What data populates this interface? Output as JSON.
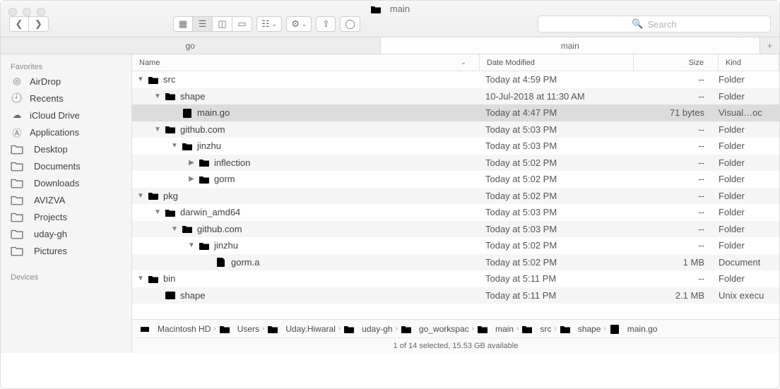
{
  "window": {
    "title": "main"
  },
  "search": {
    "placeholder": "Search"
  },
  "tabs": [
    {
      "label": "go",
      "active": false
    },
    {
      "label": "main",
      "active": true
    }
  ],
  "columns": {
    "name": "Name",
    "date": "Date Modified",
    "size": "Size",
    "kind": "Kind"
  },
  "sidebar": {
    "favorites_header": "Favorites",
    "devices_header": "Devices",
    "items": [
      {
        "label": "AirDrop",
        "icon": "airdrop"
      },
      {
        "label": "Recents",
        "icon": "clock"
      },
      {
        "label": "iCloud Drive",
        "icon": "cloud"
      },
      {
        "label": "Applications",
        "icon": "apps"
      },
      {
        "label": "Desktop",
        "icon": "folder"
      },
      {
        "label": "Documents",
        "icon": "folder"
      },
      {
        "label": "Downloads",
        "icon": "folder"
      },
      {
        "label": "AVIZVA",
        "icon": "folder"
      },
      {
        "label": "Projects",
        "icon": "folder"
      },
      {
        "label": "uday-gh",
        "icon": "folder"
      },
      {
        "label": "Pictures",
        "icon": "folder"
      }
    ]
  },
  "rows": [
    {
      "indent": 0,
      "arrow": "down",
      "icon": "folder",
      "name": "src",
      "date": "Today at 4:59 PM",
      "size": "--",
      "kind": "Folder",
      "sel": false
    },
    {
      "indent": 1,
      "arrow": "down",
      "icon": "folder",
      "name": "shape",
      "date": "10-Jul-2018 at 11:30 AM",
      "size": "--",
      "kind": "Folder",
      "sel": false
    },
    {
      "indent": 2,
      "arrow": "",
      "icon": "gofile",
      "name": "main.go",
      "date": "Today at 4:47 PM",
      "size": "71 bytes",
      "kind": "Visual…oc",
      "sel": true
    },
    {
      "indent": 1,
      "arrow": "down",
      "icon": "folder",
      "name": "github.com",
      "date": "Today at 5:03 PM",
      "size": "--",
      "kind": "Folder",
      "sel": false
    },
    {
      "indent": 2,
      "arrow": "down",
      "icon": "folder",
      "name": "jinzhu",
      "date": "Today at 5:03 PM",
      "size": "--",
      "kind": "Folder",
      "sel": false
    },
    {
      "indent": 3,
      "arrow": "right",
      "icon": "folder",
      "name": "inflection",
      "date": "Today at 5:02 PM",
      "size": "--",
      "kind": "Folder",
      "sel": false
    },
    {
      "indent": 3,
      "arrow": "right",
      "icon": "folder",
      "name": "gorm",
      "date": "Today at 5:02 PM",
      "size": "--",
      "kind": "Folder",
      "sel": false
    },
    {
      "indent": 0,
      "arrow": "down",
      "icon": "folder",
      "name": "pkg",
      "date": "Today at 5:02 PM",
      "size": "--",
      "kind": "Folder",
      "sel": false
    },
    {
      "indent": 1,
      "arrow": "down",
      "icon": "folder",
      "name": "darwin_amd64",
      "date": "Today at 5:03 PM",
      "size": "--",
      "kind": "Folder",
      "sel": false
    },
    {
      "indent": 2,
      "arrow": "down",
      "icon": "folder",
      "name": "github.com",
      "date": "Today at 5:03 PM",
      "size": "--",
      "kind": "Folder",
      "sel": false
    },
    {
      "indent": 3,
      "arrow": "down",
      "icon": "folder",
      "name": "jinzhu",
      "date": "Today at 5:02 PM",
      "size": "--",
      "kind": "Folder",
      "sel": false
    },
    {
      "indent": 4,
      "arrow": "",
      "icon": "file",
      "name": "gorm.a",
      "date": "Today at 5:02 PM",
      "size": "1 MB",
      "kind": "Document",
      "sel": false
    },
    {
      "indent": 0,
      "arrow": "down",
      "icon": "folder",
      "name": "bin",
      "date": "Today at 5:11 PM",
      "size": "--",
      "kind": "Folder",
      "sel": false
    },
    {
      "indent": 1,
      "arrow": "",
      "icon": "exec",
      "name": "shape",
      "date": "Today at 5:11 PM",
      "size": "2.1 MB",
      "kind": "Unix execu",
      "sel": false
    }
  ],
  "path": [
    {
      "label": "Macintosh HD",
      "icon": "hd"
    },
    {
      "label": "Users",
      "icon": "folder"
    },
    {
      "label": "Uday.Hiwaral",
      "icon": "folder"
    },
    {
      "label": "uday-gh",
      "icon": "folder"
    },
    {
      "label": "go_workspac",
      "icon": "folder"
    },
    {
      "label": "main",
      "icon": "folder"
    },
    {
      "label": "src",
      "icon": "folder"
    },
    {
      "label": "shape",
      "icon": "folder"
    },
    {
      "label": "main.go",
      "icon": "gofile"
    }
  ],
  "status": "1 of 14 selected, 15.53 GB available"
}
